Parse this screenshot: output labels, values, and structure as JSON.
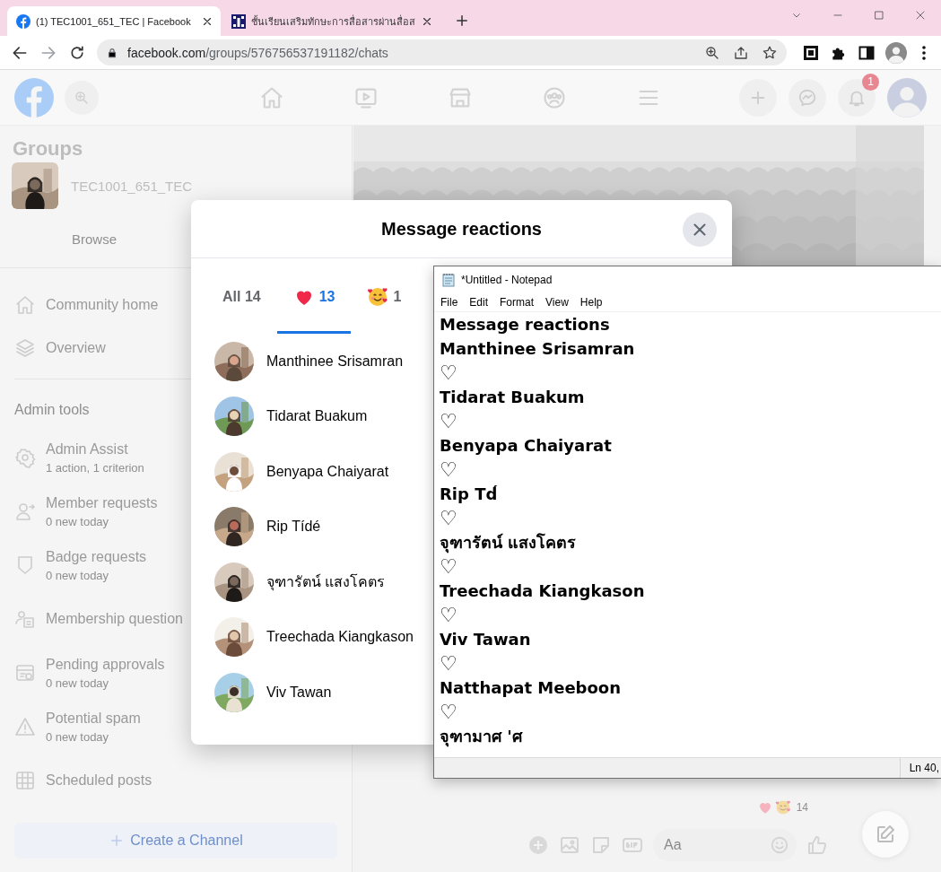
{
  "browser": {
    "tabs": [
      {
        "title": "(1) TEC1001_651_TEC | Facebook",
        "selected": true
      },
      {
        "title": "ชั้นเรียนเสริมทักษะการสื่อสารผ่านสื่อส",
        "selected": false
      }
    ],
    "address": {
      "host": "facebook.com",
      "path": "/groups/576756537191182/chats"
    }
  },
  "facebook": {
    "notification_count": "1",
    "sidebar": {
      "title": "Groups",
      "group_name": "TEC1001_651_TEC",
      "tabs": [
        {
          "label": "Browse",
          "selected": false
        }
      ],
      "items": [
        {
          "kind": "link",
          "label": "Community home"
        },
        {
          "kind": "link",
          "label": "Overview"
        },
        {
          "kind": "divider"
        },
        {
          "kind": "heading",
          "label": "Admin tools"
        },
        {
          "kind": "tool",
          "label": "Admin Assist",
          "detail": "1 action, 1 criterion"
        },
        {
          "kind": "tool",
          "label": "Member requests",
          "detail": "0 new today"
        },
        {
          "kind": "tool",
          "label": "Badge requests",
          "detail": "0 new today"
        },
        {
          "kind": "tool",
          "label": "Membership question"
        },
        {
          "kind": "tool",
          "label": "Pending approvals",
          "detail": "0 new today"
        },
        {
          "kind": "tool",
          "label": "Potential spam",
          "detail": "0 new today"
        },
        {
          "kind": "tool",
          "label": "Scheduled posts"
        }
      ],
      "button": "Create a Channel"
    },
    "chat": {
      "reaction_count": "14",
      "composer_placeholder": "Aa"
    }
  },
  "dialog": {
    "title": "Message reactions",
    "tabs": [
      {
        "kind": "all",
        "label": "All 14",
        "selected": false
      },
      {
        "kind": "heart",
        "label": "13",
        "selected": true
      },
      {
        "kind": "smile-hearts",
        "label": "1",
        "selected": false
      }
    ],
    "people": [
      {
        "name": "Manthinee Srisamran"
      },
      {
        "name": "Tidarat Buakum"
      },
      {
        "name": "Benyapa Chaiyarat"
      },
      {
        "name": "Rip Tídé"
      },
      {
        "name": "จุฑารัตน์ แสงโคตร"
      },
      {
        "name": "Treechada Kiangkason"
      },
      {
        "name": "Viv Tawan"
      }
    ]
  },
  "notepad": {
    "title": "*Untitled - Notepad",
    "menu": [
      "File",
      "Edit",
      "Format",
      "View",
      "Help"
    ],
    "lines": [
      "Message reactions",
      "Manthinee Srisamran",
      "♡",
      "Tidarat Buakum",
      "♡",
      "Benyapa Chaiyarat",
      "♡",
      "Rip Td́",
      "♡",
      "จุฑารัตน์ แสงโคตร",
      "♡",
      "Treechada Kiangkason",
      "♡",
      "Viv Tawan",
      "♡",
      "Natthapat Meeboon",
      "♡",
      "จุฑามาศ 'ศ"
    ],
    "status": "Ln 40,"
  }
}
